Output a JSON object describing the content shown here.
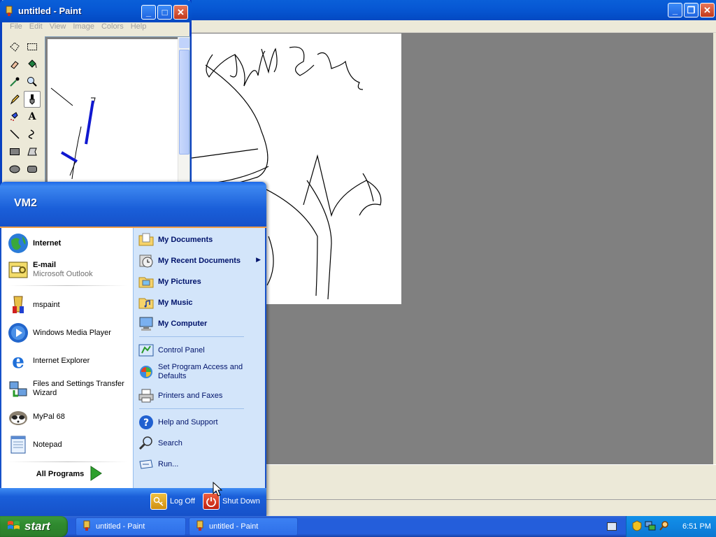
{
  "background_window": {
    "title": "untitled - Paint"
  },
  "paint_window": {
    "title": "untitled - Paint",
    "menu": [
      "File",
      "Edit",
      "View",
      "Image",
      "Colors",
      "Help"
    ],
    "tools": [
      "free-form-select",
      "rect-select",
      "eraser",
      "fill",
      "pick-color",
      "magnifier",
      "pencil",
      "brush",
      "airbrush",
      "text",
      "line",
      "curve",
      "rectangle",
      "polygon",
      "ellipse",
      "rounded-rectangle"
    ],
    "selected_tool": "brush"
  },
  "start_menu": {
    "user": "VM2",
    "pinned": [
      {
        "label": "Internet",
        "sub": ""
      },
      {
        "label": "E-mail",
        "sub": "Microsoft Outlook"
      }
    ],
    "recent": [
      {
        "label": "mspaint"
      },
      {
        "label": "Windows Media Player"
      },
      {
        "label": "Internet Explorer"
      },
      {
        "label": "Files and Settings Transfer Wizard"
      },
      {
        "label": "MyPal 68"
      },
      {
        "label": "Notepad"
      }
    ],
    "all_programs": "All Programs",
    "places": [
      {
        "label": "My Documents"
      },
      {
        "label": "My Recent Documents"
      },
      {
        "label": "My Pictures"
      },
      {
        "label": "My Music"
      },
      {
        "label": "My Computer"
      }
    ],
    "settings": [
      {
        "label": "Control Panel"
      },
      {
        "label": "Set Program Access and Defaults"
      },
      {
        "label": "Printers and Faxes"
      }
    ],
    "help": [
      {
        "label": "Help and Support"
      },
      {
        "label": "Search"
      },
      {
        "label": "Run..."
      }
    ],
    "log_off": "Log Off",
    "shut_down": "Shut Down"
  },
  "taskbar": {
    "start_label": "start",
    "tasks": [
      {
        "label": "untitled - Paint"
      },
      {
        "label": "untitled - Paint"
      }
    ],
    "clock": "6:51 PM"
  },
  "colors": {
    "xp_blue": "#245edb",
    "start_green": "#2f8a2f",
    "menu_right_bg": "#d3e5fa",
    "brush_stroke": "#1018d0"
  }
}
